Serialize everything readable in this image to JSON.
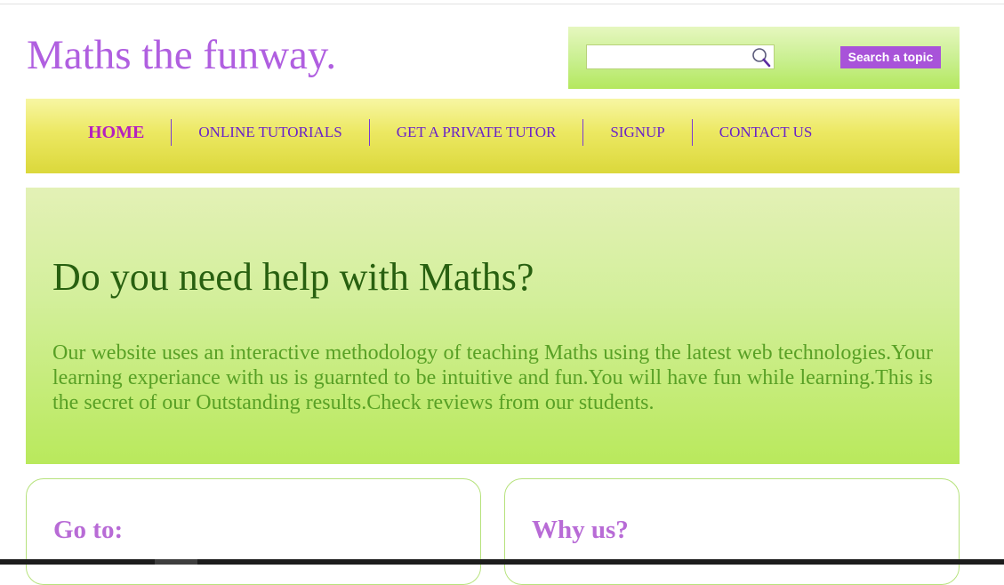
{
  "site": {
    "title": "Maths the funway."
  },
  "search": {
    "value": "",
    "placeholder": "",
    "button_label": "Search a topic",
    "icon": "search-icon"
  },
  "nav": {
    "items": [
      {
        "label": "HOME",
        "active": true
      },
      {
        "label": "ONLINE TUTORIALS",
        "active": false
      },
      {
        "label": "GET A PRIVATE TUTOR",
        "active": false
      },
      {
        "label": "SIGNUP",
        "active": false
      },
      {
        "label": "CONTACT US",
        "active": false
      }
    ]
  },
  "hero": {
    "heading": "Do you need help with Maths?",
    "text": "Our website uses an interactive methodology of teaching Maths using the latest web technologies.Your learning experiance with us is guarnted to be intuitive and fun.You will have fun while learning.This is the secret of our Outstanding results.Check reviews from our students."
  },
  "cards": [
    {
      "title": "Go to:"
    },
    {
      "title": "Why us?"
    }
  ],
  "colors": {
    "title_purple": "#b05fe0",
    "button_purple": "#a853d9",
    "nav_text": "#6a22c8",
    "nav_active": "#b51fbf",
    "hero_heading": "#286010",
    "hero_text": "#58a025",
    "card_title": "#b86bd6"
  }
}
